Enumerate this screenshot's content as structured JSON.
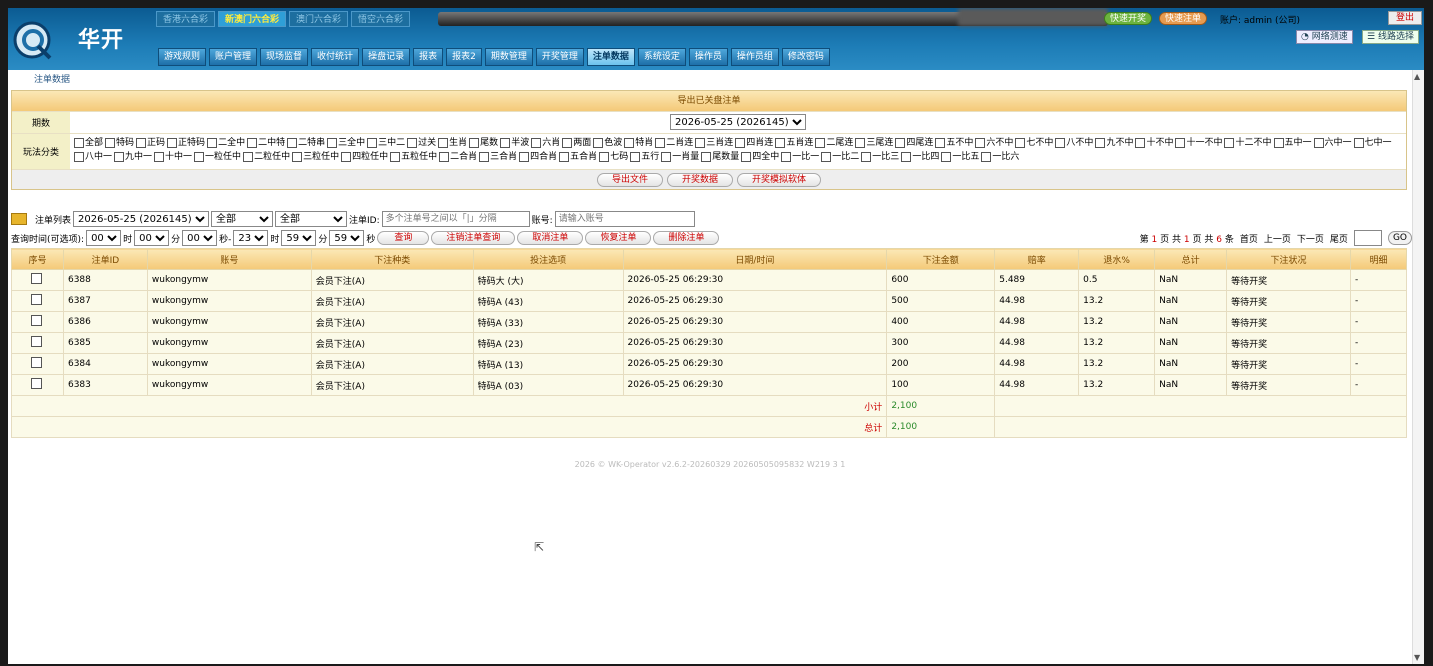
{
  "brand": "华开",
  "lottery_tabs": [
    "香港六合彩",
    "新澳门六合彩",
    "澳门六合彩",
    "悟空六合彩"
  ],
  "pills": [
    "快速开奖",
    "快速注单"
  ],
  "account": "账户: admin (公司)",
  "logout": "登出",
  "net_test": "网络测速",
  "line_select": "线路选择",
  "nav": [
    "游戏规则",
    "账户管理",
    "现场监督",
    "收付统计",
    "操盘记录",
    "报表",
    "报表2",
    "期数管理",
    "开奖管理",
    "注单数据",
    "系统设定",
    "操作员",
    "操作员组",
    "修改密码"
  ],
  "crumb": "注单数据",
  "filter": {
    "header": "导出已关盘注单",
    "period_label": "期数",
    "period_value": "2026-05-25 (2026145)",
    "play_label": "玩法分类",
    "options": [
      "全部",
      "特码",
      "正码",
      "正特码",
      "二全中",
      "二中特",
      "二特串",
      "三全中",
      "三中二",
      "过关",
      "生肖",
      "尾数",
      "半波",
      "六肖",
      "两面",
      "色波",
      "特肖",
      "二肖连",
      "三肖连",
      "四肖连",
      "五肖连",
      "二尾连",
      "三尾连",
      "四尾连",
      "五不中",
      "六不中",
      "七不中",
      "八不中",
      "九不中",
      "十不中",
      "十一不中",
      "十二不中",
      "五中一",
      "六中一",
      "七中一",
      "八中一",
      "九中一",
      "十中一",
      "一粒任中",
      "二粒任中",
      "三粒任中",
      "四粒任中",
      "五粒任中",
      "二合肖",
      "三合肖",
      "四合肖",
      "五合肖",
      "七码",
      "五行",
      "一肖量",
      "尾数量",
      "四全中",
      "一比一",
      "一比二",
      "一比三",
      "一比四",
      "一比五",
      "一比六"
    ],
    "buttons": [
      "导出文件",
      "开奖数据",
      "开奖模拟软体"
    ]
  },
  "list": {
    "label": "注单列表",
    "period": "2026-05-25 (2026145)",
    "sel1": "全部",
    "sel2": "全部",
    "id_label": "注单ID:",
    "id_placeholder": "多个注单号之间以「|」分隔",
    "acct_label": "账号:",
    "acct_placeholder": "请输入账号",
    "time_label": "查询时间(可选项):",
    "t_h1": "00",
    "u_h": "时",
    "t_m1": "00",
    "u_m": "分",
    "t_s1": "00",
    "u_s": "秒-",
    "t_h2": "23",
    "t_m2": "59",
    "t_s2": "59",
    "buttons": [
      "查询",
      "注销注单查询",
      "取消注单",
      "恢复注单",
      "删除注单"
    ]
  },
  "pager": {
    "p1": "第",
    "page": "1",
    "p2": "页 共",
    "total_pages": "1",
    "p3": "页 共",
    "count": "6",
    "p4": "条",
    "links": [
      "首页",
      "上一页",
      "下一页",
      "尾页"
    ],
    "go": "GO"
  },
  "table": {
    "headers": [
      "序号",
      "注单ID",
      "账号",
      "下注种类",
      "投注选项",
      "日期/时间",
      "下注金额",
      "赔率",
      "退水%",
      "总计",
      "下注状况",
      "明细"
    ],
    "rows": [
      [
        "6388",
        "wukongymw",
        "会员下注(A)",
        "特码大 (大)",
        "2026-05-25 06:29:30",
        "600",
        "5.489",
        "0.5",
        "NaN",
        "等待开奖",
        "-"
      ],
      [
        "6387",
        "wukongymw",
        "会员下注(A)",
        "特码A (43)",
        "2026-05-25 06:29:30",
        "500",
        "44.98",
        "13.2",
        "NaN",
        "等待开奖",
        "-"
      ],
      [
        "6386",
        "wukongymw",
        "会员下注(A)",
        "特码A (33)",
        "2026-05-25 06:29:30",
        "400",
        "44.98",
        "13.2",
        "NaN",
        "等待开奖",
        "-"
      ],
      [
        "6385",
        "wukongymw",
        "会员下注(A)",
        "特码A (23)",
        "2026-05-25 06:29:30",
        "300",
        "44.98",
        "13.2",
        "NaN",
        "等待开奖",
        "-"
      ],
      [
        "6384",
        "wukongymw",
        "会员下注(A)",
        "特码A (13)",
        "2026-05-25 06:29:30",
        "200",
        "44.98",
        "13.2",
        "NaN",
        "等待开奖",
        "-"
      ],
      [
        "6383",
        "wukongymw",
        "会员下注(A)",
        "特码A (03)",
        "2026-05-25 06:29:30",
        "100",
        "44.98",
        "13.2",
        "NaN",
        "等待开奖",
        "-"
      ]
    ],
    "subtotal_label": "小计",
    "subtotal": "2,100",
    "total_label": "总计",
    "total": "2,100"
  },
  "footer": "2026 © WK-Operator v2.6.2-20260329 20260505095832 W219 3 1"
}
